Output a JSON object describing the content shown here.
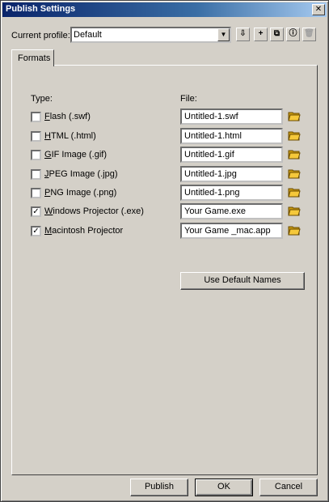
{
  "window": {
    "title": "Publish Settings",
    "close_glyph": "✕"
  },
  "profile": {
    "label": "Current profile:",
    "value": "Default",
    "dropdown_glyph": "▼"
  },
  "toolbar": [
    {
      "name": "import-export-profile-icon",
      "glyph": "⇩",
      "disabled": false
    },
    {
      "name": "create-profile-icon",
      "glyph": "+",
      "disabled": false
    },
    {
      "name": "duplicate-profile-icon",
      "glyph": "⧉",
      "disabled": false
    },
    {
      "name": "profile-properties-icon",
      "glyph": "ⓘ",
      "disabled": false
    },
    {
      "name": "delete-profile-icon",
      "glyph": "🗑",
      "disabled": true
    }
  ],
  "tabs": [
    {
      "label": "Formats"
    }
  ],
  "headers": {
    "type": "Type:",
    "file": "File:"
  },
  "formats": [
    {
      "accel": "F",
      "label": "lash  (.swf)",
      "checked": false,
      "file": "Untitled-1.swf"
    },
    {
      "accel": "H",
      "label": "TML  (.html)",
      "checked": false,
      "file": "Untitled-1.html"
    },
    {
      "accel": "G",
      "label": "IF Image  (.gif)",
      "checked": false,
      "file": "Untitled-1.gif"
    },
    {
      "accel": "J",
      "label": "PEG Image  (.jpg)",
      "checked": false,
      "file": "Untitled-1.jpg"
    },
    {
      "accel": "P",
      "label": "NG Image  (.png)",
      "checked": false,
      "file": "Untitled-1.png"
    },
    {
      "accel": "W",
      "label": "indows Projector  (.exe)",
      "checked": true,
      "file": "Your Game.exe"
    },
    {
      "accel": "M",
      "label": "acintosh Projector",
      "checked": true,
      "file": "Your Game _mac.app"
    }
  ],
  "buttons": {
    "default_names": "Use Default Names",
    "publish": "Publish",
    "ok": "OK",
    "cancel": "Cancel"
  },
  "check_glyph": "✓"
}
